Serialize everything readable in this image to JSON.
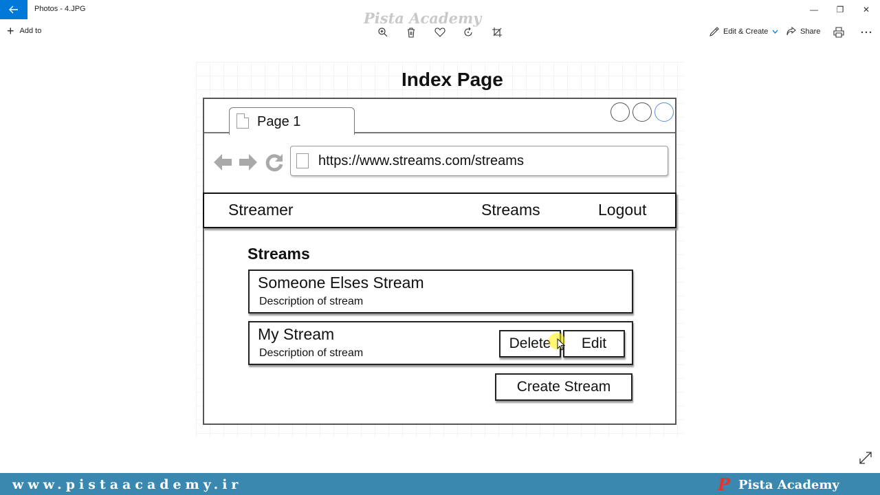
{
  "window": {
    "title": "Photos - 4.JPG",
    "watermark": "Pista Academy",
    "controls": {
      "minimize": "—",
      "restore": "❐",
      "close": "✕"
    }
  },
  "toolbar": {
    "add_to_label": "Add to",
    "icons": [
      "zoom-in-icon",
      "delete-icon",
      "heart-icon",
      "rotate-icon",
      "crop-icon"
    ],
    "edit_create_label": "Edit & Create",
    "share_label": "Share"
  },
  "image": {
    "heading": "Index Page",
    "browser": {
      "tab_label": "Page 1",
      "url": "https://www.streams.com/streams"
    },
    "navbar": {
      "brand": "Streamer",
      "streams_link": "Streams",
      "logout_link": "Logout"
    },
    "section_title": "Streams",
    "streams": [
      {
        "title": "Someone Elses Stream",
        "description": "Description of stream"
      },
      {
        "title": "My Stream",
        "description": "Description of stream",
        "delete_label": "Delete",
        "edit_label": "Edit"
      }
    ],
    "create_button": "Create Stream"
  },
  "footer": {
    "url": "www.pistaacademy.ir",
    "logo_letter": "P",
    "brand": "Pista Academy"
  },
  "colors": {
    "accent_blue": "#0078d7",
    "footer_band": "#3a87b0",
    "logo_red": "#e3342f"
  }
}
